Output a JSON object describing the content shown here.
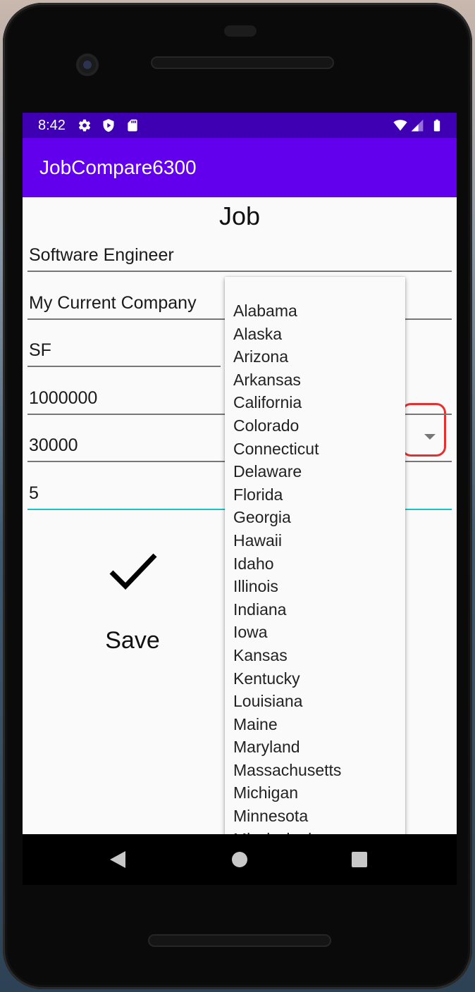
{
  "status_bar": {
    "time": "8:42",
    "left_icons": [
      "gear-icon",
      "shield-icon",
      "sd-card-icon"
    ],
    "right_icons": [
      "wifi-icon",
      "signal-icon",
      "battery-icon"
    ]
  },
  "app_bar": {
    "title": "JobCompare6300",
    "color": "#6200ee",
    "status_color": "#3f00b4"
  },
  "form": {
    "heading": "Job",
    "title_value": "Software Engineer",
    "company_value": "My Current Company",
    "city_value": "SF",
    "salary_value": "1000000",
    "bonus_value": "30000",
    "last_value": "5"
  },
  "state_dropdown": {
    "options": [
      "Alabama",
      "Alaska",
      "Arizona",
      "Arkansas",
      "California",
      "Colorado",
      "Connecticut",
      "Delaware",
      "Florida",
      "Georgia",
      "Hawaii",
      "Idaho",
      "Illinois",
      "Indiana",
      "Iowa",
      "Kansas",
      "Kentucky",
      "Louisiana",
      "Maine",
      "Maryland",
      "Massachusetts",
      "Michigan",
      "Minnesota",
      "Mississippi"
    ]
  },
  "save": {
    "icon": "checkmark-icon",
    "label": "Save"
  },
  "nav_bar": {
    "icons": [
      "back-icon",
      "home-icon",
      "recents-icon"
    ]
  },
  "colors": {
    "focus_underline": "#19c4c0",
    "highlight": "#e53030"
  }
}
